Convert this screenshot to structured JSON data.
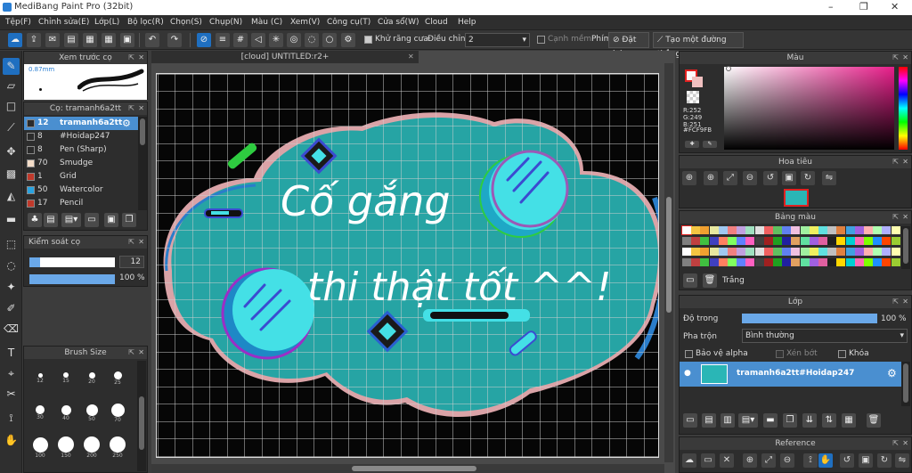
{
  "app": {
    "title": "MediBang Paint Pro (32bit)",
    "controls": [
      "–",
      "❐",
      "✕"
    ]
  },
  "menu": [
    "Tệp(F)",
    "Chỉnh sửa(E)",
    "Lớp(L)",
    "Bộ lọc(R)",
    "Chọn(S)",
    "Chụp(N)",
    "Màu (C)",
    "Xem(V)",
    "Công cụ(T)",
    "Cửa sổ(W)",
    "Cloud",
    "Help"
  ],
  "toolbar": {
    "antialias_label": "Khử răng cưa",
    "correction_label": "Điều chỉnh",
    "correction_value": "2",
    "edge_label": "Cạnh mềm",
    "keys_label": "Phím",
    "reset_label": "Đặt lại",
    "straight_label": "Tạo một đường thẳng"
  },
  "brush_preview": {
    "title": "Xem trước cọ",
    "size": "0.87mm"
  },
  "brush_list": {
    "title": "Cọ: tramanh6a2tt",
    "items": [
      {
        "num": "12",
        "name": "tramanh6a2tt",
        "color": "#2b2b2b",
        "selected": true
      },
      {
        "num": "8",
        "name": "#Hoidap247",
        "color": "#2b2b2b"
      },
      {
        "num": "8",
        "name": "Pen (Sharp)",
        "color": "#2b2b2b"
      },
      {
        "num": "70",
        "name": "Smudge",
        "color": "#f3dcc8"
      },
      {
        "num": "1",
        "name": "Grid",
        "color": "#c0392b"
      },
      {
        "num": "50",
        "name": "Watercolor",
        "color": "#29a3e0"
      },
      {
        "num": "17",
        "name": "Pencil",
        "color": "#c0392b"
      }
    ]
  },
  "brush_control": {
    "title": "Kiểm soát cọ",
    "size_value": "12",
    "opacity_value": "100 %",
    "size_fraction": 0.12,
    "opacity_fraction": 1.0
  },
  "brush_size": {
    "title": "Brush Size",
    "sizes": [
      "12",
      "15",
      "20",
      "25",
      "30",
      "40",
      "50",
      "70",
      "100",
      "150",
      "200",
      "250"
    ]
  },
  "document": {
    "tab": "[cloud] UNTITLED:r2+"
  },
  "artwork": {
    "line1": "Cố gắng",
    "line2": "thi thật tốt ^^!"
  },
  "color_panel": {
    "title": "Màu",
    "r": "R:252",
    "g": "G:249",
    "b": "B:251",
    "hex": "#FCF9FB"
  },
  "navigator": {
    "title": "Hoa tiêu"
  },
  "palette": {
    "title": "Bảng màu",
    "selected_name": "Trắng"
  },
  "layers": {
    "title": "Lớp",
    "opacity_label": "Độ trong",
    "opacity_value": "100 %",
    "opacity_fraction": 1.0,
    "blend_label": "Pha trộn",
    "blend_value": "Bình thường",
    "protect_alpha": "Bảo vệ alpha",
    "clipping": "Xén bớt",
    "lock": "Khóa",
    "layer_name": "tramanh6a2tt#Hoidap247"
  },
  "reference": {
    "title": "Reference"
  }
}
